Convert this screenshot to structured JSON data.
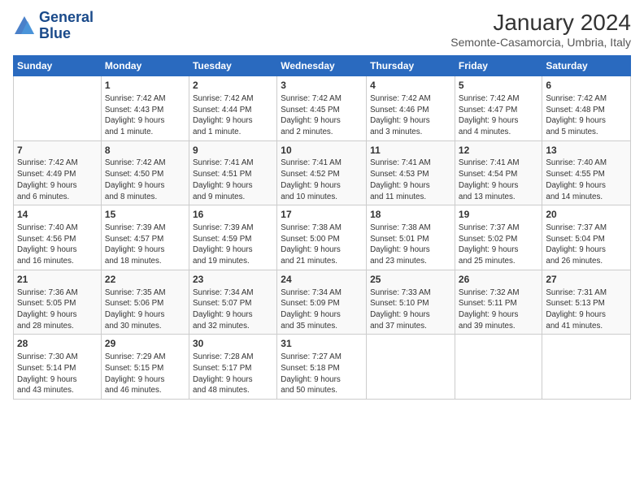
{
  "logo": {
    "line1": "General",
    "line2": "Blue"
  },
  "title": "January 2024",
  "subtitle": "Semonte-Casamorcia, Umbria, Italy",
  "days": [
    "Sunday",
    "Monday",
    "Tuesday",
    "Wednesday",
    "Thursday",
    "Friday",
    "Saturday"
  ],
  "weeks": [
    [
      {
        "num": "",
        "lines": []
      },
      {
        "num": "1",
        "lines": [
          "Sunrise: 7:42 AM",
          "Sunset: 4:43 PM",
          "Daylight: 9 hours",
          "and 1 minute."
        ]
      },
      {
        "num": "2",
        "lines": [
          "Sunrise: 7:42 AM",
          "Sunset: 4:44 PM",
          "Daylight: 9 hours",
          "and 1 minute."
        ]
      },
      {
        "num": "3",
        "lines": [
          "Sunrise: 7:42 AM",
          "Sunset: 4:45 PM",
          "Daylight: 9 hours",
          "and 2 minutes."
        ]
      },
      {
        "num": "4",
        "lines": [
          "Sunrise: 7:42 AM",
          "Sunset: 4:46 PM",
          "Daylight: 9 hours",
          "and 3 minutes."
        ]
      },
      {
        "num": "5",
        "lines": [
          "Sunrise: 7:42 AM",
          "Sunset: 4:47 PM",
          "Daylight: 9 hours",
          "and 4 minutes."
        ]
      },
      {
        "num": "6",
        "lines": [
          "Sunrise: 7:42 AM",
          "Sunset: 4:48 PM",
          "Daylight: 9 hours",
          "and 5 minutes."
        ]
      }
    ],
    [
      {
        "num": "7",
        "lines": [
          "Sunrise: 7:42 AM",
          "Sunset: 4:49 PM",
          "Daylight: 9 hours",
          "and 6 minutes."
        ]
      },
      {
        "num": "8",
        "lines": [
          "Sunrise: 7:42 AM",
          "Sunset: 4:50 PM",
          "Daylight: 9 hours",
          "and 8 minutes."
        ]
      },
      {
        "num": "9",
        "lines": [
          "Sunrise: 7:41 AM",
          "Sunset: 4:51 PM",
          "Daylight: 9 hours",
          "and 9 minutes."
        ]
      },
      {
        "num": "10",
        "lines": [
          "Sunrise: 7:41 AM",
          "Sunset: 4:52 PM",
          "Daylight: 9 hours",
          "and 10 minutes."
        ]
      },
      {
        "num": "11",
        "lines": [
          "Sunrise: 7:41 AM",
          "Sunset: 4:53 PM",
          "Daylight: 9 hours",
          "and 11 minutes."
        ]
      },
      {
        "num": "12",
        "lines": [
          "Sunrise: 7:41 AM",
          "Sunset: 4:54 PM",
          "Daylight: 9 hours",
          "and 13 minutes."
        ]
      },
      {
        "num": "13",
        "lines": [
          "Sunrise: 7:40 AM",
          "Sunset: 4:55 PM",
          "Daylight: 9 hours",
          "and 14 minutes."
        ]
      }
    ],
    [
      {
        "num": "14",
        "lines": [
          "Sunrise: 7:40 AM",
          "Sunset: 4:56 PM",
          "Daylight: 9 hours",
          "and 16 minutes."
        ]
      },
      {
        "num": "15",
        "lines": [
          "Sunrise: 7:39 AM",
          "Sunset: 4:57 PM",
          "Daylight: 9 hours",
          "and 18 minutes."
        ]
      },
      {
        "num": "16",
        "lines": [
          "Sunrise: 7:39 AM",
          "Sunset: 4:59 PM",
          "Daylight: 9 hours",
          "and 19 minutes."
        ]
      },
      {
        "num": "17",
        "lines": [
          "Sunrise: 7:38 AM",
          "Sunset: 5:00 PM",
          "Daylight: 9 hours",
          "and 21 minutes."
        ]
      },
      {
        "num": "18",
        "lines": [
          "Sunrise: 7:38 AM",
          "Sunset: 5:01 PM",
          "Daylight: 9 hours",
          "and 23 minutes."
        ]
      },
      {
        "num": "19",
        "lines": [
          "Sunrise: 7:37 AM",
          "Sunset: 5:02 PM",
          "Daylight: 9 hours",
          "and 25 minutes."
        ]
      },
      {
        "num": "20",
        "lines": [
          "Sunrise: 7:37 AM",
          "Sunset: 5:04 PM",
          "Daylight: 9 hours",
          "and 26 minutes."
        ]
      }
    ],
    [
      {
        "num": "21",
        "lines": [
          "Sunrise: 7:36 AM",
          "Sunset: 5:05 PM",
          "Daylight: 9 hours",
          "and 28 minutes."
        ]
      },
      {
        "num": "22",
        "lines": [
          "Sunrise: 7:35 AM",
          "Sunset: 5:06 PM",
          "Daylight: 9 hours",
          "and 30 minutes."
        ]
      },
      {
        "num": "23",
        "lines": [
          "Sunrise: 7:34 AM",
          "Sunset: 5:07 PM",
          "Daylight: 9 hours",
          "and 32 minutes."
        ]
      },
      {
        "num": "24",
        "lines": [
          "Sunrise: 7:34 AM",
          "Sunset: 5:09 PM",
          "Daylight: 9 hours",
          "and 35 minutes."
        ]
      },
      {
        "num": "25",
        "lines": [
          "Sunrise: 7:33 AM",
          "Sunset: 5:10 PM",
          "Daylight: 9 hours",
          "and 37 minutes."
        ]
      },
      {
        "num": "26",
        "lines": [
          "Sunrise: 7:32 AM",
          "Sunset: 5:11 PM",
          "Daylight: 9 hours",
          "and 39 minutes."
        ]
      },
      {
        "num": "27",
        "lines": [
          "Sunrise: 7:31 AM",
          "Sunset: 5:13 PM",
          "Daylight: 9 hours",
          "and 41 minutes."
        ]
      }
    ],
    [
      {
        "num": "28",
        "lines": [
          "Sunrise: 7:30 AM",
          "Sunset: 5:14 PM",
          "Daylight: 9 hours",
          "and 43 minutes."
        ]
      },
      {
        "num": "29",
        "lines": [
          "Sunrise: 7:29 AM",
          "Sunset: 5:15 PM",
          "Daylight: 9 hours",
          "and 46 minutes."
        ]
      },
      {
        "num": "30",
        "lines": [
          "Sunrise: 7:28 AM",
          "Sunset: 5:17 PM",
          "Daylight: 9 hours",
          "and 48 minutes."
        ]
      },
      {
        "num": "31",
        "lines": [
          "Sunrise: 7:27 AM",
          "Sunset: 5:18 PM",
          "Daylight: 9 hours",
          "and 50 minutes."
        ]
      },
      {
        "num": "",
        "lines": []
      },
      {
        "num": "",
        "lines": []
      },
      {
        "num": "",
        "lines": []
      }
    ]
  ]
}
